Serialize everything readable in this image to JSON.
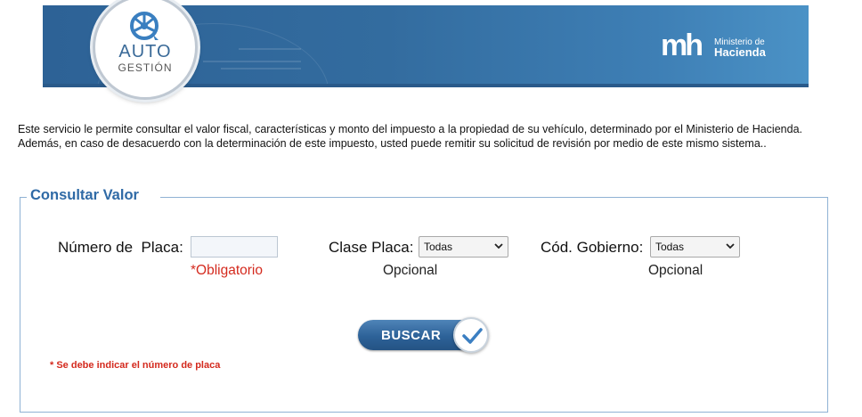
{
  "header": {
    "logo_auto": "AUTO",
    "logo_gestion": "GESTIÓN",
    "ministry_mark": "mh",
    "ministry_line1": "Ministerio de",
    "ministry_line2": "Hacienda"
  },
  "intro_text": "Este servicio le permite consultar el valor fiscal, características y monto del impuesto a la propiedad de su vehículo, determinado por el Ministerio de Hacienda. Además, en caso de desacuerdo con la determinación de este impuesto, usted puede remitir su solicitud de revisión por medio de este mismo sistema..",
  "form": {
    "legend": "Consultar Valor",
    "plate": {
      "label": "Número de  Placa:",
      "value": "",
      "requirement": "*Obligatorio"
    },
    "class": {
      "label": "Clase Placa:",
      "selected": "Todas",
      "requirement": "Opcional"
    },
    "gov_code": {
      "label": "Cód. Gobierno:",
      "selected": "Todas",
      "requirement": "Opcional"
    },
    "search_button": "BUSCAR",
    "validation_note": "* Se debe indicar el número de placa"
  },
  "colors": {
    "banner": "#336c9f",
    "legend": "#2f6aa6",
    "required": "#d42a1e",
    "button": "#2d6298"
  }
}
